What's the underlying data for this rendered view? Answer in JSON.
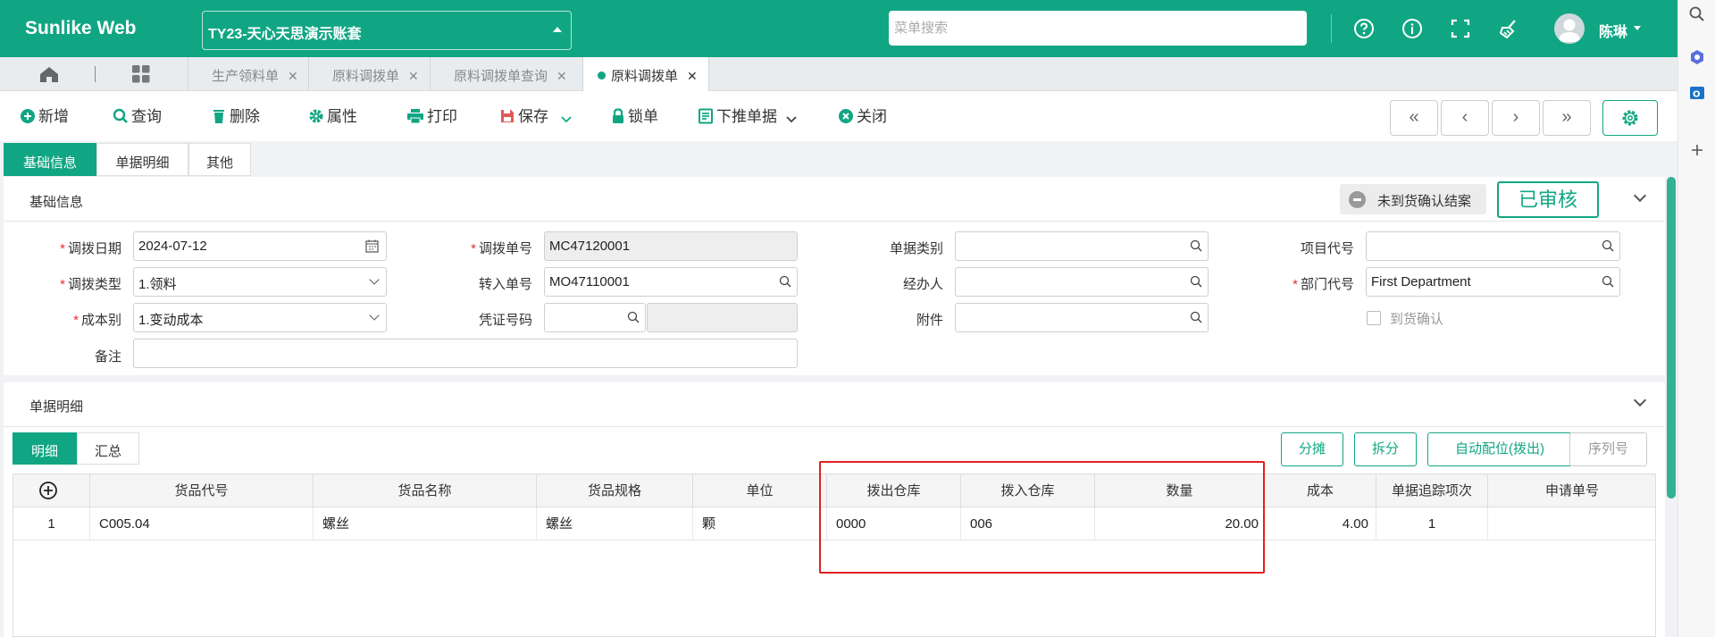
{
  "header": {
    "brand": "Sunlike Web",
    "account": "TY23-天心天思演示账套",
    "menu_search_placeholder": "菜单搜索",
    "username": "陈琳"
  },
  "page_tabs": [
    {
      "label": "生产领料单"
    },
    {
      "label": "原料调拨单"
    },
    {
      "label": "原料调拨单查询"
    },
    {
      "label": "原料调拨单",
      "active": true
    }
  ],
  "toolbar": {
    "new": "新增",
    "query": "查询",
    "delete": "删除",
    "properties": "属性",
    "print": "打印",
    "save": "保存",
    "lock": "锁单",
    "push_down": "下推单据",
    "close": "关闭",
    "nav_first": "«",
    "nav_prev": "‹",
    "nav_next": "›",
    "nav_last": "»"
  },
  "section_tabs": [
    "基础信息",
    "单据明细",
    "其他"
  ],
  "basic": {
    "title": "基础信息",
    "unconfirmed_btn": "未到货确认结案",
    "status": "已审核",
    "fields": {
      "transfer_date": {
        "label": "调拨日期",
        "value": "2024-07-12"
      },
      "transfer_no": {
        "label": "调拨单号",
        "value": "MC47120001"
      },
      "doc_category": {
        "label": "单据类别",
        "value": ""
      },
      "project_code": {
        "label": "项目代号",
        "value": ""
      },
      "transfer_type": {
        "label": "调拨类型",
        "value": "1.领料"
      },
      "inbound_no": {
        "label": "转入单号",
        "value": "MO47110001"
      },
      "handler": {
        "label": "经办人",
        "value": ""
      },
      "dept_code": {
        "label": "部门代号",
        "value": "First Department"
      },
      "cost_type": {
        "label": "成本别",
        "value": "1.变动成本"
      },
      "voucher_no": {
        "label": "凭证号码",
        "value": ""
      },
      "attachment": {
        "label": "附件",
        "value": ""
      },
      "arrival_confirm": {
        "label": "到货确认"
      },
      "remark": {
        "label": "备注",
        "value": ""
      }
    }
  },
  "detail": {
    "title": "单据明细",
    "subtabs": [
      "明细",
      "汇总"
    ],
    "buttons": [
      "分摊",
      "拆分",
      "自动配位(拨出)",
      "序列号"
    ],
    "columns": [
      "货品代号",
      "货品名称",
      "货品规格",
      "单位",
      "拨出仓库",
      "拨入仓库",
      "数量",
      "成本",
      "单据追踪项次",
      "申请单号"
    ],
    "rows": [
      {
        "no": "1",
        "item_code": "C005.04",
        "item_name": "螺丝",
        "spec": "螺丝",
        "unit": "颗",
        "out_wh": "0000",
        "in_wh": "006",
        "qty": "20.00",
        "cost": "4.00",
        "trace": "1",
        "apply_no": ""
      }
    ]
  },
  "colors": {
    "brand": "#11a683",
    "highlight": "#e02020"
  }
}
